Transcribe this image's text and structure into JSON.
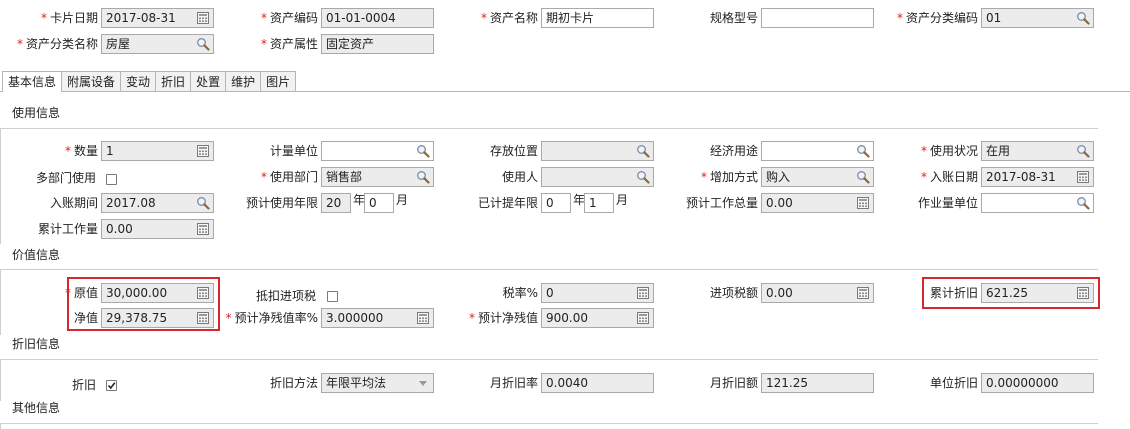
{
  "header": {
    "card_date": {
      "label": "卡片日期",
      "value": "2017-08-31"
    },
    "asset_code": {
      "label": "资产编码",
      "value": "01-01-0004"
    },
    "asset_name": {
      "label": "资产名称",
      "value": "期初卡片"
    },
    "spec_model": {
      "label": "规格型号",
      "value": ""
    },
    "category_code": {
      "label": "资产分类编码",
      "value": "01"
    },
    "category_name": {
      "label": "资产分类名称",
      "value": "房屋"
    },
    "asset_attr": {
      "label": "资产属性",
      "value": "固定资产"
    }
  },
  "tabs": [
    "基本信息",
    "附属设备",
    "变动",
    "折旧",
    "处置",
    "维护",
    "图片"
  ],
  "usage": {
    "title": "使用信息",
    "quantity": {
      "label": "数量",
      "value": "1"
    },
    "unit": {
      "label": "计量单位",
      "value": ""
    },
    "location": {
      "label": "存放位置",
      "value": ""
    },
    "econ_use": {
      "label": "经济用途",
      "value": ""
    },
    "status": {
      "label": "使用状况",
      "value": "在用"
    },
    "multi_dept": {
      "label": "多部门使用",
      "checked": false
    },
    "dept": {
      "label": "使用部门",
      "value": "销售部"
    },
    "user": {
      "label": "使用人",
      "value": ""
    },
    "add_method": {
      "label": "增加方式",
      "value": "购入"
    },
    "entry_date": {
      "label": "入账日期",
      "value": "2017-08-31"
    },
    "entry_period": {
      "label": "入账期间",
      "value": "2017.08"
    },
    "expected_life": {
      "label": "预计使用年限",
      "years": "20",
      "months": "0"
    },
    "depreciated_life": {
      "label": "已计提年限",
      "years": "0",
      "months": "1"
    },
    "expected_workload": {
      "label": "预计工作总量",
      "value": "0.00"
    },
    "workload_unit": {
      "label": "作业量单位",
      "value": ""
    },
    "accum_workload": {
      "label": "累计工作量",
      "value": "0.00"
    },
    "year_unit": "年",
    "month_unit": "月"
  },
  "value": {
    "title": "价值信息",
    "original": {
      "label": "原值",
      "value": "30,000.00"
    },
    "net": {
      "label": "净值",
      "value": "29,378.75"
    },
    "deduct_tax": {
      "label": "抵扣进项税",
      "checked": false
    },
    "residual_rate": {
      "label": "预计净残值率%",
      "value": "3.000000"
    },
    "tax_rate": {
      "label": "税率%",
      "value": "0"
    },
    "residual_value": {
      "label": "预计净残值",
      "value": "900.00"
    },
    "input_tax": {
      "label": "进项税额",
      "value": "0.00"
    },
    "accum_dep": {
      "label": "累计折旧",
      "value": "621.25"
    }
  },
  "depreciation": {
    "title": "折旧信息",
    "depreciate": {
      "label": "折旧",
      "checked": true
    },
    "method": {
      "label": "折旧方法",
      "value": "年限平均法"
    },
    "monthly_rate": {
      "label": "月折旧率",
      "value": "0.0040"
    },
    "monthly_amount": {
      "label": "月折旧额",
      "value": "121.25"
    },
    "unit_dep": {
      "label": "单位折旧",
      "value": "0.00000000"
    }
  },
  "other": {
    "title": "其他信息"
  },
  "colors": {
    "required": "#e02020",
    "highlight": "#d22a2a",
    "field_bg": "#ececec"
  }
}
